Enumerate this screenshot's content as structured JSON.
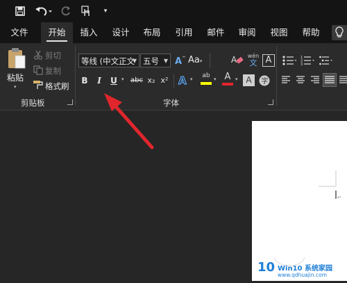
{
  "tabs": [
    "文件",
    "开始",
    "插入",
    "设计",
    "布局",
    "引用",
    "邮件",
    "审阅",
    "视图",
    "帮助"
  ],
  "clipboard": {
    "paste_label": "粘贴",
    "cut_label": "剪切",
    "copy_label": "复制",
    "format_painter_label": "格式刷",
    "group_label": "剪贴板"
  },
  "font": {
    "font_name": "等线 (中文正文",
    "font_size": "五号",
    "group_label": "字体",
    "bold": "B",
    "italic": "I",
    "underline": "U",
    "strike": "abc",
    "subscript": "x₂",
    "superscript": "x²",
    "case": "Aa",
    "wen": "文",
    "font_color_letter": "A",
    "highlight_letters": "ab",
    "border_letter": "A"
  },
  "watermark": {
    "number": "10",
    "brand": "Win10 系统家园",
    "url": "www.qdhuajin.com"
  },
  "colors": {
    "background": "#262626",
    "title_bar": "#141414",
    "ribbon": "#2b2b2b",
    "arrow": "#e0262c",
    "highlight_yellow": "#ffff00",
    "font_red": "#e3242b",
    "watermark_blue": "#1e7fd6"
  },
  "icons": [
    "save-icon",
    "undo-icon",
    "redo-icon",
    "touch-mode-icon",
    "customize-qat-icon",
    "lightbulb-icon",
    "paste-icon",
    "cut-icon",
    "copy-icon",
    "format-painter-icon",
    "clear-formatting-icon",
    "phonetic-guide-icon",
    "text-effects-icon",
    "bullets-icon",
    "numbering-icon",
    "align-left-icon",
    "center-icon",
    "align-right-icon",
    "justify-icon"
  ]
}
